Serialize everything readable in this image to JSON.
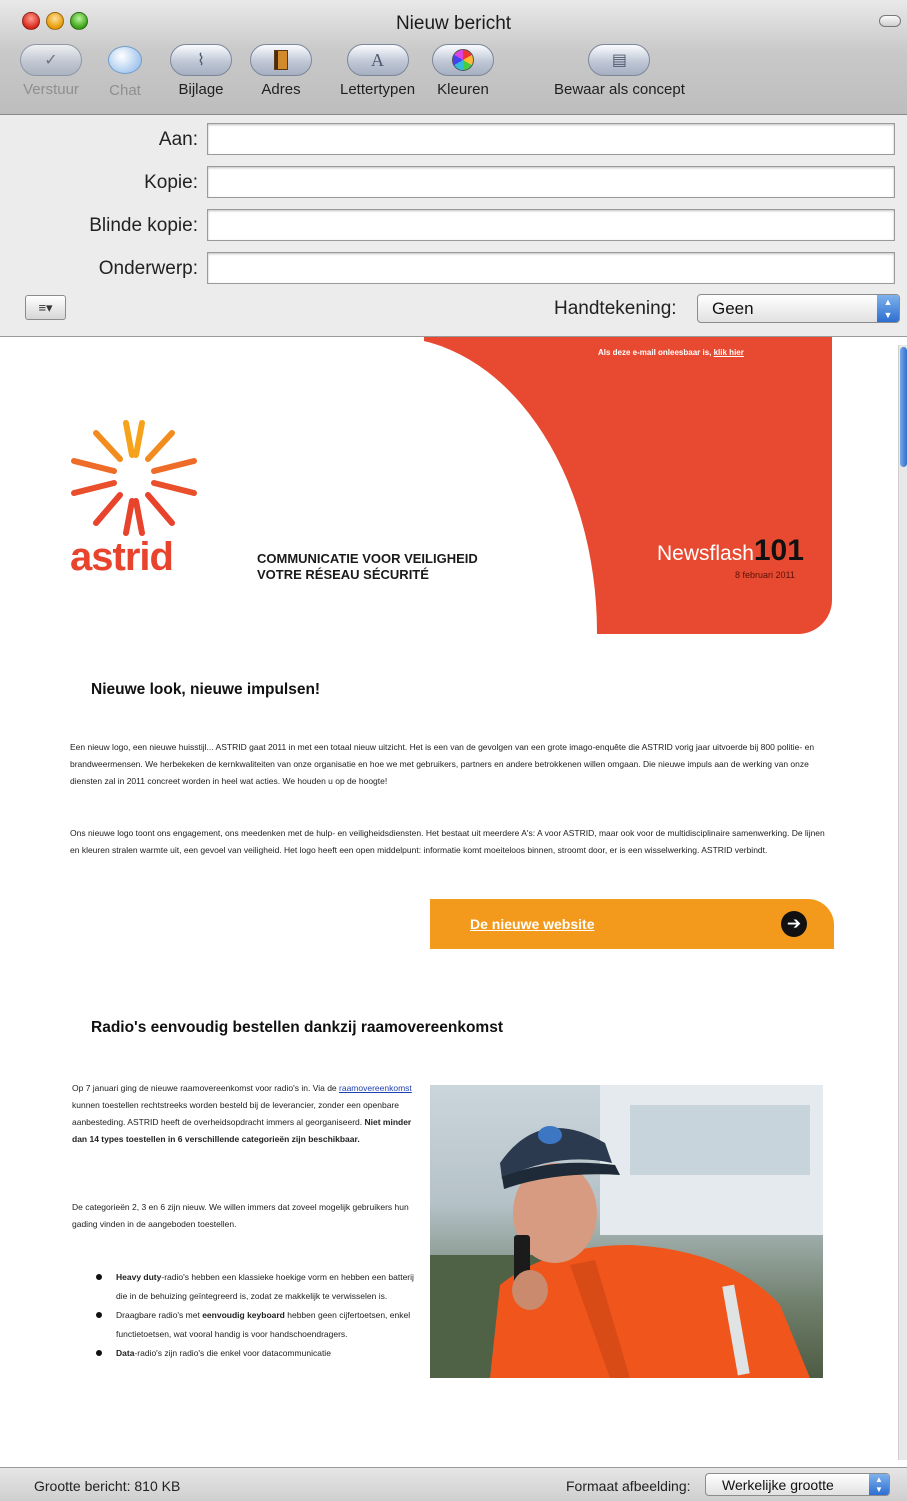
{
  "window": {
    "title": "Nieuw bericht"
  },
  "toolbar": {
    "items": [
      {
        "label": "Verstuur",
        "icon": "send-icon",
        "enabled": false
      },
      {
        "label": "Chat",
        "icon": "chat-bubble-icon",
        "enabled": false
      },
      {
        "label": "Bijlage",
        "icon": "paperclip-icon",
        "enabled": true
      },
      {
        "label": "Adres",
        "icon": "address-book-icon",
        "enabled": true
      },
      {
        "label": "Lettertypen",
        "icon": "fonts-icon",
        "enabled": true
      },
      {
        "label": "Kleuren",
        "icon": "color-wheel-icon",
        "enabled": true
      },
      {
        "label": "Bewaar als concept",
        "icon": "draft-document-icon",
        "enabled": true
      }
    ]
  },
  "headers": {
    "to_label": "Aan:",
    "to_value": "",
    "cc_label": "Kopie:",
    "cc_value": "",
    "bcc_label": "Blinde kopie:",
    "bcc_value": "",
    "subject_label": "Onderwerp:",
    "subject_value": "",
    "format_button": "≡▾",
    "signature_label": "Handtekening:",
    "signature_value": "Geen"
  },
  "newsletter": {
    "view_online": "Als deze e-mail onleesbaar is, ",
    "view_online_link": "klik hier",
    "logo_word": "astrid",
    "tagline_1": "COMMUNICATIE VOOR VEILIGHEID",
    "tagline_2": "VOTRE RÉSEAU SÉCURITÉ",
    "newsflash_word": "Newsflash",
    "newsflash_number": "101",
    "newsflash_date": "8 februari 2011",
    "brand_red": "#e84a31",
    "brand_orange": "#f39a1c",
    "article1": {
      "title": "Nieuwe look, nieuwe impulsen!",
      "para1": "Een nieuw logo, een nieuwe huisstijl... ASTRID gaat 2011 in met een totaal nieuw uitzicht. Het is een van de gevolgen van een grote imago-enquête die ASTRID vorig jaar uitvoerde bij 800 politie- en brandweermensen. We herbekeken de kernkwaliteiten van onze organisatie en hoe we met gebruikers, partners en andere betrokkenen willen omgaan. Die nieuwe impuls aan de werking van onze diensten zal in 2011 concreet worden in heel wat acties. We houden u op de hoogte!",
      "para2": "Ons nieuwe logo toont ons engagement, ons meedenken met de hulp- en veiligheidsdiensten. Het bestaat uit meerdere A's: A voor ASTRID, maar ook voor de multidisciplinaire samenwerking. De lijnen en kleuren stralen warmte uit, een gevoel van veiligheid. Het logo heeft een open middelpunt: informatie komt moeiteloos binnen, stroomt door, er is een wisselwerking. ASTRID verbindt.",
      "cta": "De nieuwe website"
    },
    "article2": {
      "title": "Radio's eenvoudig bestellen dankzij raamovereenkomst",
      "p1_a": "Op 7 januari ging de nieuwe raamovereenkomst voor radio's in. Via de ",
      "p1_link": "raamovereenkomst",
      "p1_b": " kunnen toestellen rechtstreeks worden besteld bij de leverancier, zonder een openbare aanbesteding. ASTRID heeft de overheidsopdracht immers al georganiseerd. ",
      "p1_bold": "Niet minder dan 14 types toestellen in 6 verschillende categorieën zijn beschikbaar.",
      "p2": "De categorieën 2, 3 en 6 zijn nieuw. We willen immers dat zoveel mogelijk gebruikers hun gading vinden in de aangeboden toestellen.",
      "bullet1_bold": "Heavy duty",
      "bullet1": "-radio's hebben een klassieke hoekige vorm en hebben een batterij die in de behuizing geïntegreerd is, zodat ze makkelijk te verwisselen is.",
      "bullet2_a": "Draagbare radio's met ",
      "bullet2_bold": "eenvoudig keyboard",
      "bullet2_b": " hebben geen cijfertoetsen, enkel functietoetsen, wat vooral handig is voor handschoendragers.",
      "bullet3_bold": "Data",
      "bullet3": "-radio's zijn radio's die enkel voor datacommunicatie"
    }
  },
  "statusbar": {
    "size_text": "Grootte bericht: 810 KB",
    "image_format_label": "Formaat afbeelding:",
    "image_format_value": "Werkelijke grootte"
  }
}
